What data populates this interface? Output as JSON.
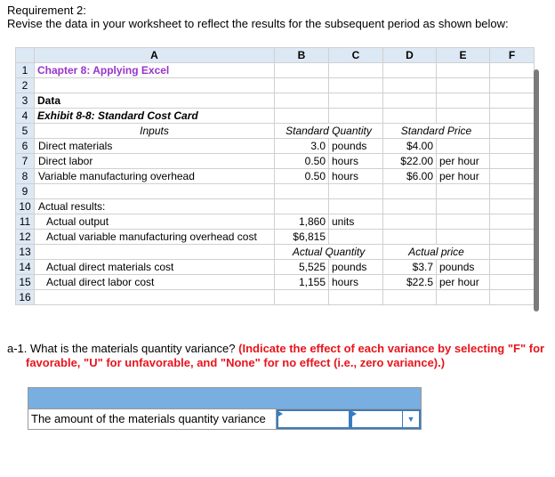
{
  "requirement": {
    "title": "Requirement 2:",
    "text": "Revise the data in your worksheet to reflect the results for the subsequent period as shown below:"
  },
  "columns": [
    "A",
    "B",
    "C",
    "D",
    "E",
    "F"
  ],
  "rows": [
    {
      "n": "1",
      "a": "Chapter 8: Applying Excel",
      "b": "",
      "c": "",
      "d": "",
      "e": ""
    },
    {
      "n": "2",
      "a": "",
      "b": "",
      "c": "",
      "d": "",
      "e": ""
    },
    {
      "n": "3",
      "a": "Data",
      "b": "",
      "c": "",
      "d": "",
      "e": ""
    },
    {
      "n": "4",
      "a": "Exhibit 8-8: Standard Cost Card",
      "b": "",
      "c": "",
      "d": "",
      "e": ""
    },
    {
      "n": "5",
      "a": "Inputs",
      "bc": "Standard Quantity",
      "de": "Standard Price"
    },
    {
      "n": "6",
      "a": "Direct materials",
      "b": "3.0",
      "c": "pounds",
      "d": "$4.00",
      "e": ""
    },
    {
      "n": "7",
      "a": "Direct labor",
      "b": "0.50",
      "c": "hours",
      "d": "$22.00",
      "e": "per hour"
    },
    {
      "n": "8",
      "a": "Variable manufacturing overhead",
      "b": "0.50",
      "c": "hours",
      "d": "$6.00",
      "e": "per hour"
    },
    {
      "n": "9",
      "a": "",
      "b": "",
      "c": "",
      "d": "",
      "e": ""
    },
    {
      "n": "10",
      "a": "Actual results:",
      "b": "",
      "c": "",
      "d": "",
      "e": ""
    },
    {
      "n": "11",
      "a": "Actual output",
      "b": "1,860",
      "c": "units",
      "d": "",
      "e": ""
    },
    {
      "n": "12",
      "a": "Actual variable manufacturing overhead cost",
      "b": "$6,815",
      "c": "",
      "d": "",
      "e": ""
    },
    {
      "n": "13",
      "a": "",
      "bc": "Actual Quantity",
      "de": "Actual price"
    },
    {
      "n": "14",
      "a": "Actual direct materials cost",
      "b": "5,525",
      "c": "pounds",
      "d": "$3.7",
      "e": "pounds"
    },
    {
      "n": "15",
      "a": "Actual direct labor cost",
      "b": "1,155",
      "c": "hours",
      "d": "$22.5",
      "e": "per hour"
    },
    {
      "n": "16",
      "a": "",
      "b": "",
      "c": "",
      "d": "",
      "e": ""
    }
  ],
  "question": {
    "prefix": "a-1. What is the materials quantity variance?",
    "instruction_1": "(Indicate the effect of each variance by selecting \"F\" for",
    "instruction_2": "favorable, \"U\" for unfavorable, and \"None\" for no effect (i.e., zero variance).)"
  },
  "answer": {
    "label": "The amount of the materials quantity variance",
    "amount": "",
    "effect": ""
  }
}
